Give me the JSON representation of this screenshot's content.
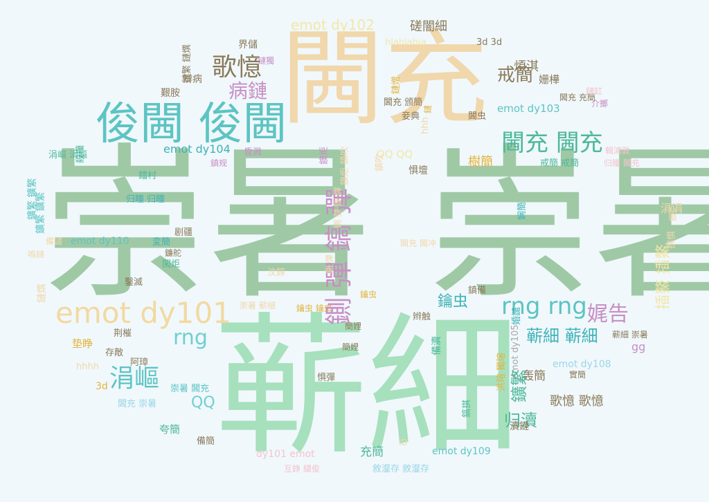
{
  "palette": {
    "background": "#f0f8fc",
    "sage": "#9fc9a5",
    "mint": "#a6e0bc",
    "peach": "#f1d7ac",
    "teal": "#5dc4c2",
    "teal_dark": "#3fb2b6",
    "mauve": "#c88fc4",
    "gold": "#e3b33c",
    "brown": "#8a7a5a",
    "rose": "#f3c4cc",
    "cream": "#f2e7a8",
    "sky": "#9cd6e6",
    "grey": "#a8a8a8"
  },
  "words": [
    {
      "text": "崇暑 崇暑",
      "color": "#9fc9a5"
    },
    {
      "text": "蕲細",
      "color": "#a6e0bc"
    },
    {
      "text": "閪充",
      "color": "#f1d7ac"
    },
    {
      "text": "俊閪 俊閪",
      "color": "#5dc4c2"
    },
    {
      "text": "emot dy101",
      "color": "#f2d9a0"
    },
    {
      "text": "rng rng",
      "color": "#5dc4c2"
    },
    {
      "text": "閪充 閪充",
      "color": "#4fb89a"
    },
    {
      "text": "歌憶",
      "color": "#8a7a5a"
    },
    {
      "text": "病鏈",
      "color": "#c88fc4"
    },
    {
      "text": "涓嶇",
      "color": "#5dc4c2"
    },
    {
      "text": "rng",
      "color": "#6fcfd0"
    },
    {
      "text": "娓告",
      "color": "#c88fc4"
    },
    {
      "text": "戒簡",
      "color": "#8a7a5a"
    },
    {
      "text": "蕲細 蕲細",
      "color": "#3fb2b6"
    },
    {
      "text": "emot dy102",
      "color": "#f2e7a8"
    },
    {
      "text": "emot dy104",
      "color": "#3fb2b6"
    },
    {
      "text": "emot dy103",
      "color": "#5dc4c2"
    },
    {
      "text": "emot dy110",
      "color": "#5dc4c2"
    },
    {
      "text": "emot dy108",
      "color": "#9cd6e6"
    },
    {
      "text": "emot dy109",
      "color": "#5dc4c2"
    },
    {
      "text": "QQ",
      "color": "#6fcfd0"
    },
    {
      "text": "鑰虫",
      "color": "#3fb2b6"
    },
    {
      "text": "归瀆",
      "color": "#4fb89a"
    },
    {
      "text": "歌憶 歌憶",
      "color": "#8a7a5a"
    },
    {
      "text": "轰簡",
      "color": "#8a7a5a"
    },
    {
      "text": "煩淇",
      "color": "#8a7a5a"
    },
    {
      "text": "姗樺",
      "color": "#8a7a5a"
    },
    {
      "text": "閪充 充簡",
      "color": "#8a7a5a"
    },
    {
      "text": "樹簡",
      "color": "#e3b33c"
    },
    {
      "text": "戒簡 戒簡",
      "color": "#4fb89a"
    },
    {
      "text": "归瞳 閪充",
      "color": "#f3c4cc"
    },
    {
      "text": "磋闇細",
      "color": "#8a7a5a"
    },
    {
      "text": "3d 3d",
      "color": "#8a7a5a"
    },
    {
      "text": "hiahiahia",
      "color": "#f2e7a8"
    },
    {
      "text": "界儲",
      "color": "#8a7a5a"
    },
    {
      "text": "鏈獨",
      "color": "#c88fc4"
    },
    {
      "text": "辨病",
      "color": "#8a7a5a"
    },
    {
      "text": "艱胺",
      "color": "#8a7a5a"
    },
    {
      "text": "QQ QQ",
      "color": "#f2e7a8"
    },
    {
      "text": "閪充 颁簡",
      "color": "#8a7a5a"
    },
    {
      "text": "妾典",
      "color": "#8a7a5a"
    },
    {
      "text": "閪虫",
      "color": "#8a7a5a"
    },
    {
      "text": "惧壇",
      "color": "#8a7a5a"
    },
    {
      "text": "昏溅",
      "color": "#c88fc4"
    },
    {
      "text": "鎮规",
      "color": "#c88fc4"
    },
    {
      "text": "涓嶇 涓嶇",
      "color": "#4fb89a"
    },
    {
      "text": "归瞳 归瞳",
      "color": "#3fb2b6"
    },
    {
      "text": "鐳村",
      "color": "#4fb89a"
    },
    {
      "text": "涓涓",
      "color": "#f1d7ac"
    },
    {
      "text": "輯鴻敦",
      "color": "#f3c4cc"
    },
    {
      "text": "備譴",
      "color": "#f1d7ac"
    },
    {
      "text": "変簡",
      "color": "#3fb2b6"
    },
    {
      "text": "剧疆",
      "color": "#8a7a5a"
    },
    {
      "text": "闖炬",
      "color": "#4fb89a"
    },
    {
      "text": "鑿滅",
      "color": "#8a7a5a"
    },
    {
      "text": "汶鎵",
      "color": "#f1d7ac"
    },
    {
      "text": "崇暑 蕲細",
      "color": "#f1d7ac"
    },
    {
      "text": "鑰虫 鑰虫",
      "color": "#e3b33c"
    },
    {
      "text": "簡娌",
      "color": "#8a7a5a"
    },
    {
      "text": "鎮備",
      "color": "#8a7a5a"
    },
    {
      "text": "辫触",
      "color": "#8a7a5a"
    },
    {
      "text": "閪充 閪冲",
      "color": "#f1d7ac"
    },
    {
      "text": "蕲細 崇暑",
      "color": "#8a7a5a"
    },
    {
      "text": "gg",
      "color": "#c88fc4"
    },
    {
      "text": "垫睁",
      "color": "#e3b33c"
    },
    {
      "text": "荆槯",
      "color": "#8a7a5a"
    },
    {
      "text": "存敵",
      "color": "#8a7a5a"
    },
    {
      "text": "阿璋",
      "color": "#8a7a5a"
    },
    {
      "text": "hhhh",
      "color": "#f1d7ac"
    },
    {
      "text": "3d",
      "color": "#e3b33c"
    },
    {
      "text": "崇暑 閪充",
      "color": "#5dc4c2"
    },
    {
      "text": "閪充 崇暑",
      "color": "#9cd6e6"
    },
    {
      "text": "夸簡",
      "color": "#4fb89a"
    },
    {
      "text": "備簡",
      "color": "#8a7a5a"
    },
    {
      "text": "充簡",
      "color": "#4fb89a"
    },
    {
      "text": "ID",
      "color": "#f1d7ac"
    },
    {
      "text": "敘瀣存 敘瀣存",
      "color": "#9cd6e6"
    },
    {
      "text": "互錚 繾俊",
      "color": "#f3c4cc"
    },
    {
      "text": "惧彈",
      "color": "#8a7a5a"
    },
    {
      "text": "簡娌",
      "color": "#8a7a5a"
    },
    {
      "text": "實簡",
      "color": "#8a7a5a"
    },
    {
      "text": "嗚鏈",
      "color": "#f1d7ac"
    },
    {
      "text": "dy101 emot",
      "color": "#f3c4cc"
    },
    {
      "text": "瀆鏈",
      "color": "#8a7a5a"
    },
    {
      "text": "介擲",
      "color": "#c88fc4"
    },
    {
      "text": "鏈缸",
      "color": "#f3c4cc"
    },
    {
      "text": "鐮舵",
      "color": "#8a7a5a"
    },
    {
      "text": "鑰虫",
      "color": "#e3b33c"
    }
  ],
  "vertical_words": [
    {
      "text": "鍘 彈 鎬 彈",
      "color": "#c88fc4"
    },
    {
      "text": "插鰲 插鰲",
      "color": "#f2e7a8"
    },
    {
      "text": "鑛繁 鑛繁",
      "color": "#5dc4c2"
    },
    {
      "text": "鑛繁 鑛繁",
      "color": "#5dc4c2"
    },
    {
      "text": "鏈熼",
      "color": "#f1d7ac"
    },
    {
      "text": "殺欗",
      "color": "#4fb89a"
    },
    {
      "text": "鏈繁 鏈熼",
      "color": "#8a7a5a"
    },
    {
      "text": "鏈熷",
      "color": "#e3b33c"
    },
    {
      "text": "hhh",
      "color": "#f1d7ac"
    },
    {
      "text": "鐭炬",
      "color": "#c88fc4"
    },
    {
      "text": "鐭炬 鎮吹",
      "color": "#f1d7ac"
    },
    {
      "text": "鎮吹",
      "color": "#f1d7ac"
    },
    {
      "text": "emot dy105",
      "color": "#a8a8a8"
    },
    {
      "text": "洪瑢 獨瑢",
      "color": "#e3b33c"
    },
    {
      "text": "婚譴",
      "color": "#3fb2b6"
    },
    {
      "text": "鑛繁",
      "color": "#4fb89a"
    },
    {
      "text": "備瀆",
      "color": "#4fb89a"
    },
    {
      "text": "鎬掑",
      "color": "#4fb89a"
    },
    {
      "text": "娴簡",
      "color": "#3fb2b6"
    },
    {
      "text": "撰惧",
      "color": "#f1d7ac"
    },
    {
      "text": "鍘 彈 鍘 彈",
      "color": "#f1d7ac"
    },
    {
      "text": "鍘 彈",
      "color": "#f1d7ac"
    },
    {
      "text": "鏈",
      "color": "#e3b33c"
    },
    {
      "text": "鐭炬",
      "color": "#f1d7ac"
    }
  ]
}
